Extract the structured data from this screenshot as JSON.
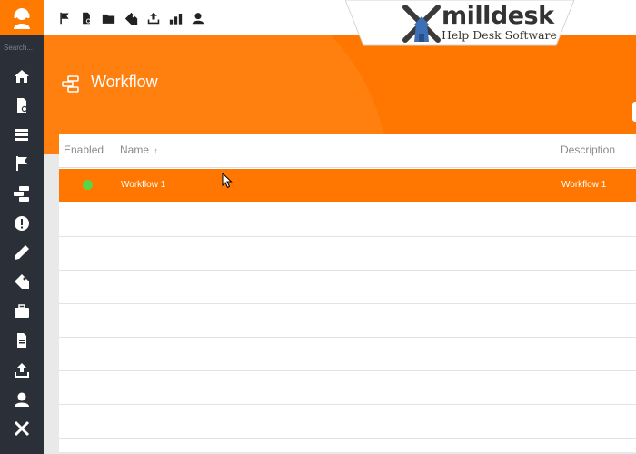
{
  "sidebar": {
    "search_placeholder": "Search...",
    "items": [
      {
        "icon": "home-icon"
      },
      {
        "icon": "document-gear-icon"
      },
      {
        "icon": "list-icon"
      },
      {
        "icon": "flag-icon"
      },
      {
        "icon": "workflow-icon"
      },
      {
        "icon": "alert-icon"
      },
      {
        "icon": "pencil-icon"
      },
      {
        "icon": "tag-icon"
      },
      {
        "icon": "briefcase-icon"
      },
      {
        "icon": "report-icon"
      },
      {
        "icon": "upload-icon"
      },
      {
        "icon": "user-icon"
      },
      {
        "icon": "tools-icon"
      }
    ]
  },
  "toolbar": {
    "icons": [
      "flag-icon",
      "document-gear-icon",
      "folder-icon",
      "tag-icon",
      "upload-icon",
      "bar-chart-icon",
      "user-icon"
    ]
  },
  "logo": {
    "title": "milldesk",
    "subtitle": "Help Desk Software"
  },
  "page": {
    "title": "Workflow"
  },
  "table": {
    "columns": {
      "enabled": "Enabled",
      "name": "Name",
      "name_sort": "↑",
      "description": "Description"
    },
    "rows": [
      {
        "enabled": true,
        "name": "Workflow 1",
        "description": "Workflow 1",
        "selected": true
      }
    ]
  },
  "colors": {
    "accent": "#ff7700",
    "sidebar": "#2b2f37",
    "enabled_dot": "#5ad548"
  }
}
